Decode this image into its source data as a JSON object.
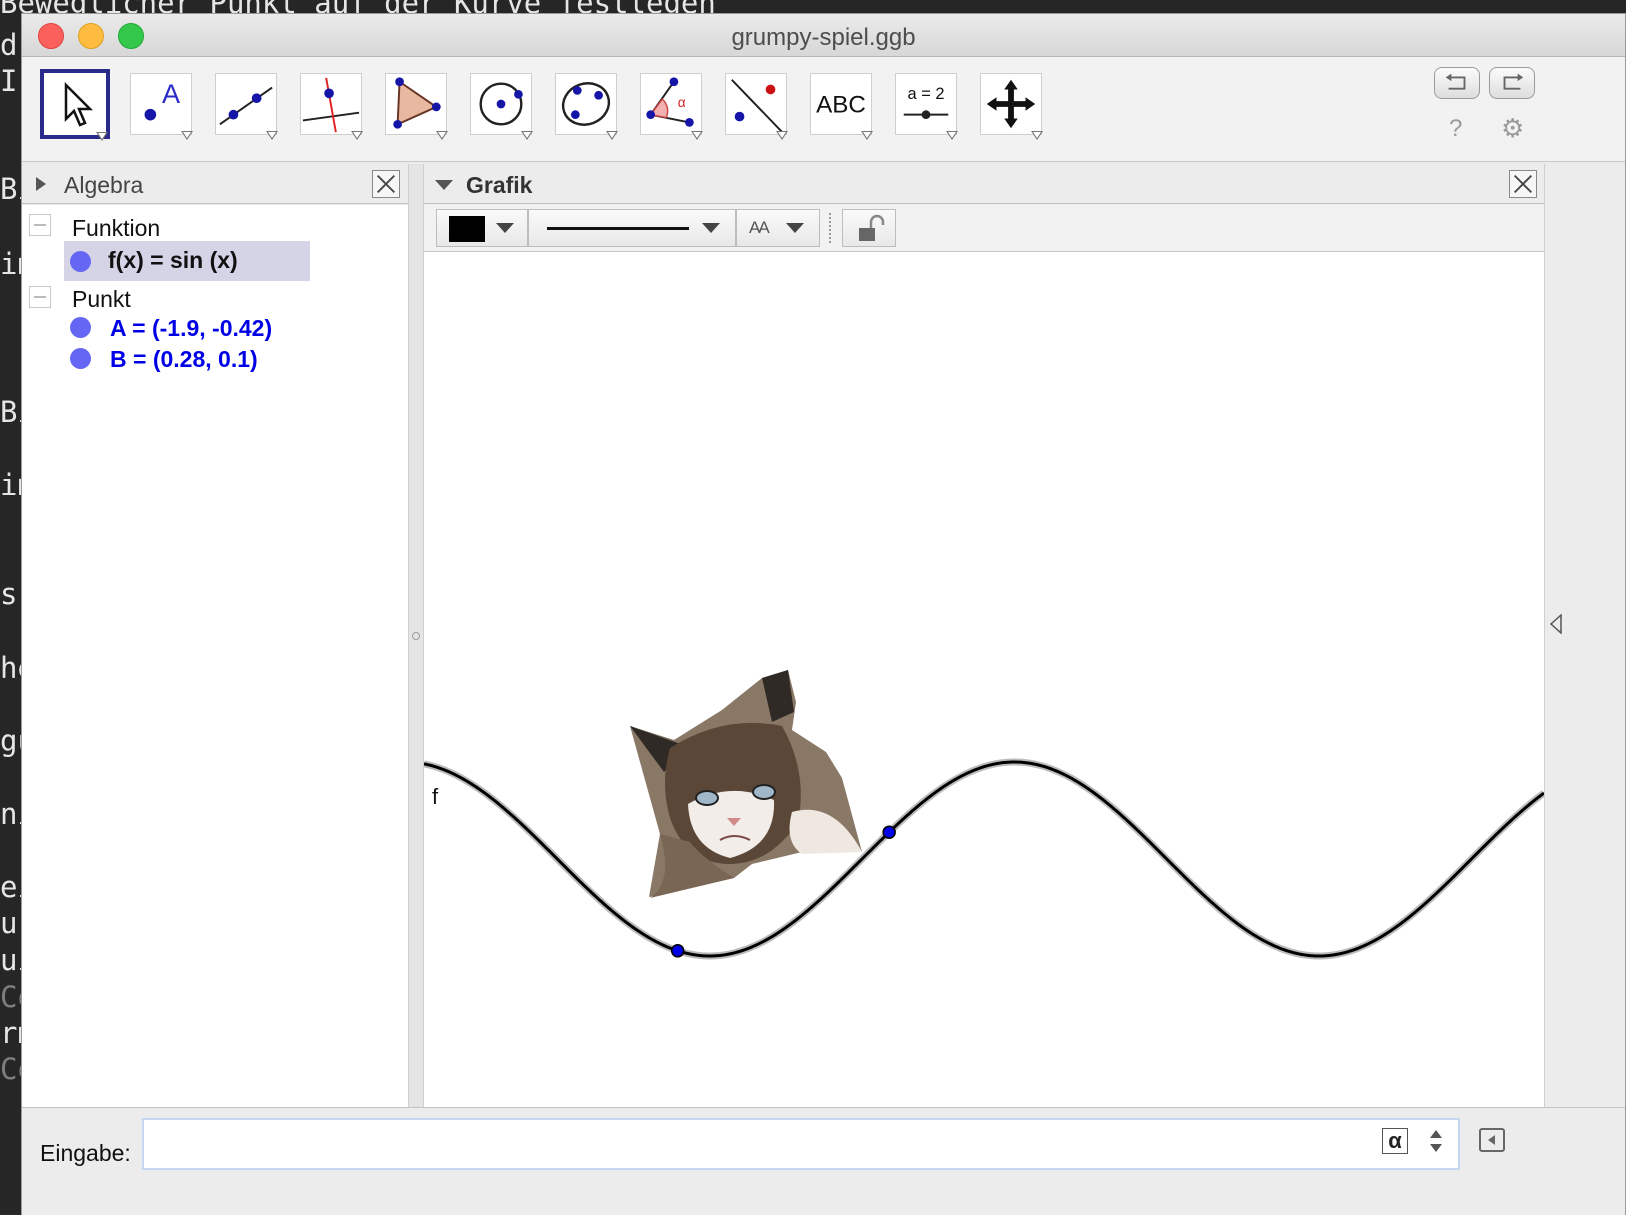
{
  "terminal": {
    "top_text": "Beweglicher Punkt auf der Kurve festlegen",
    "lines": [
      "d",
      "I",
      "",
      "Bi",
      "",
      "im",
      "",
      "Bi",
      "",
      "im",
      "",
      "s",
      "",
      "he",
      "",
      "gu",
      "",
      "ni",
      "",
      "ei",
      "ur",
      "ui",
      "Co",
      "rm",
      "Co"
    ]
  },
  "window": {
    "title": "grumpy-spiel.ggb"
  },
  "toolbar": {
    "tools": [
      {
        "name": "move-tool",
        "icon": "arrow-pointer-icon"
      },
      {
        "name": "point-tool",
        "icon": "point-A-icon",
        "label": "A"
      },
      {
        "name": "line-tool",
        "icon": "line-through-points-icon"
      },
      {
        "name": "perpendicular-tool",
        "icon": "perpendicular-line-icon"
      },
      {
        "name": "polygon-tool",
        "icon": "polygon-icon"
      },
      {
        "name": "circle-tool",
        "icon": "circle-center-point-icon"
      },
      {
        "name": "conic-tool",
        "icon": "ellipse-icon"
      },
      {
        "name": "angle-tool",
        "icon": "angle-icon",
        "label": "α"
      },
      {
        "name": "reflect-tool",
        "icon": "reflect-about-line-icon"
      },
      {
        "name": "text-tool",
        "icon": "text-icon",
        "label": "ABC"
      },
      {
        "name": "slider-tool",
        "icon": "slider-icon",
        "label": "a = 2"
      },
      {
        "name": "move-graphics-tool",
        "icon": "move-view-icon"
      }
    ],
    "help_glyph": "?",
    "settings_glyph": "⚙"
  },
  "algebra": {
    "title": "Algebra",
    "groups": [
      {
        "label": "Funktion",
        "items": [
          {
            "text": "f(x)  =  sin (x)",
            "color": "#111111",
            "selected": true
          }
        ]
      },
      {
        "label": "Punkt",
        "items": [
          {
            "text": "A = (-1.9, -0.42)",
            "color": "#0000e6",
            "selected": false
          },
          {
            "text": "B = (0.28, 0.1)",
            "color": "#0000e6",
            "selected": false
          }
        ]
      }
    ]
  },
  "grafik": {
    "title": "Grafik",
    "style_bar": {
      "color": "#000000",
      "font_glyph": "AA"
    },
    "function_label": "f",
    "curve": {
      "function": "sin(x)"
    },
    "points": [
      {
        "name": "A",
        "x": -1.9,
        "y": -0.42
      },
      {
        "name": "B",
        "x": 0.28,
        "y": 0.1
      }
    ],
    "image_object": "grumpy-cat-image"
  },
  "input": {
    "label": "Eingabe:",
    "value": "",
    "alpha_glyph": "α"
  },
  "colors": {
    "selection": "#d4d4e6",
    "point": "#0000e6",
    "algebra_dot": "#6666f5"
  }
}
